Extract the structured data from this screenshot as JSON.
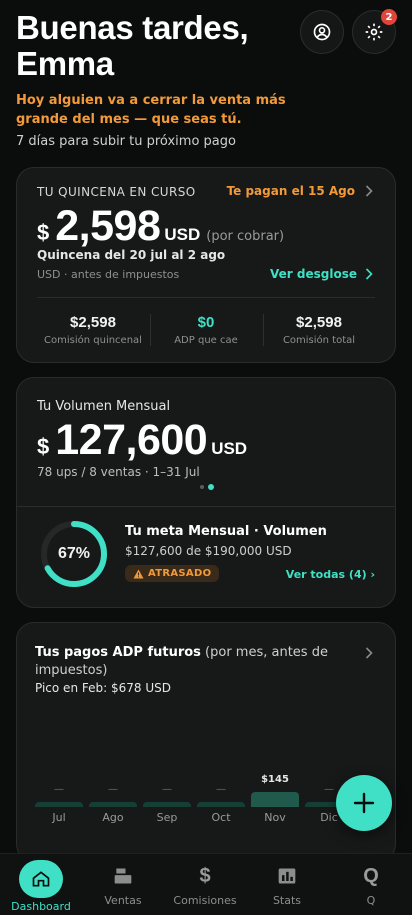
{
  "header": {
    "greeting": "Buenas tardes,",
    "name": "Emma",
    "tagline": "Hoy alguien va a cerrar la venta más grande del mes — que seas tú.",
    "subline": "7 días para subir tu próximo pago",
    "notifications_count": "2"
  },
  "paycheck": {
    "label": "TU QUINCENA EN CURSO",
    "paid_on": "Te pagan el 15 Ago",
    "currency_symbol": "$",
    "amount": "2,598",
    "currency": "USD",
    "status": "(por cobrar)",
    "period": "Quincena del 20 jul al 2 ago",
    "note": "USD · antes de impuestos",
    "breakdown_link": "Ver desglose",
    "stats": [
      {
        "value": "$2,598",
        "label": "Comisión quincenal"
      },
      {
        "value": "$0",
        "label": "ADP que cae"
      },
      {
        "value": "$2,598",
        "label": "Comisión total"
      }
    ]
  },
  "volume": {
    "label": "Tu Volumen Mensual",
    "currency_symbol": "$",
    "amount": "127,600",
    "currency": "USD",
    "detail": "78 ups / 8 ventas · 1–31 Jul",
    "goal": {
      "percent_label": "67%",
      "progress": 0.67,
      "title": "Tu meta Mensual · Volumen",
      "progress_text": "$127,600 de $190,000 USD",
      "status": "ATRASADO",
      "link": "Ver todas (4)"
    }
  },
  "future_payments": {
    "title": "Tus pagos ADP futuros",
    "title_note": "(por mes, antes de impuestos)",
    "peak": "Pico en Feb: $678 USD",
    "chart_data": {
      "type": "bar",
      "categories": [
        "Jul",
        "Ago",
        "Sep",
        "Oct",
        "Nov",
        "Dic"
      ],
      "values": [
        null,
        null,
        null,
        null,
        145,
        null
      ],
      "data_labels": [
        "—",
        "—",
        "—",
        "—",
        "$145",
        "—"
      ]
    }
  },
  "nav": {
    "items": [
      {
        "label": "Dashboard",
        "icon": "home-icon"
      },
      {
        "label": "Ventas",
        "icon": "cash-register-icon"
      },
      {
        "label": "Comisiones",
        "icon": "dollar-icon"
      },
      {
        "label": "Stats",
        "icon": "bar-chart-icon"
      },
      {
        "label": "Q",
        "icon": "q-icon"
      }
    ]
  },
  "colors": {
    "accent": "#3fe0c5",
    "warning": "#f29a3a",
    "background": "#0b0c0c",
    "card": "#171918"
  }
}
